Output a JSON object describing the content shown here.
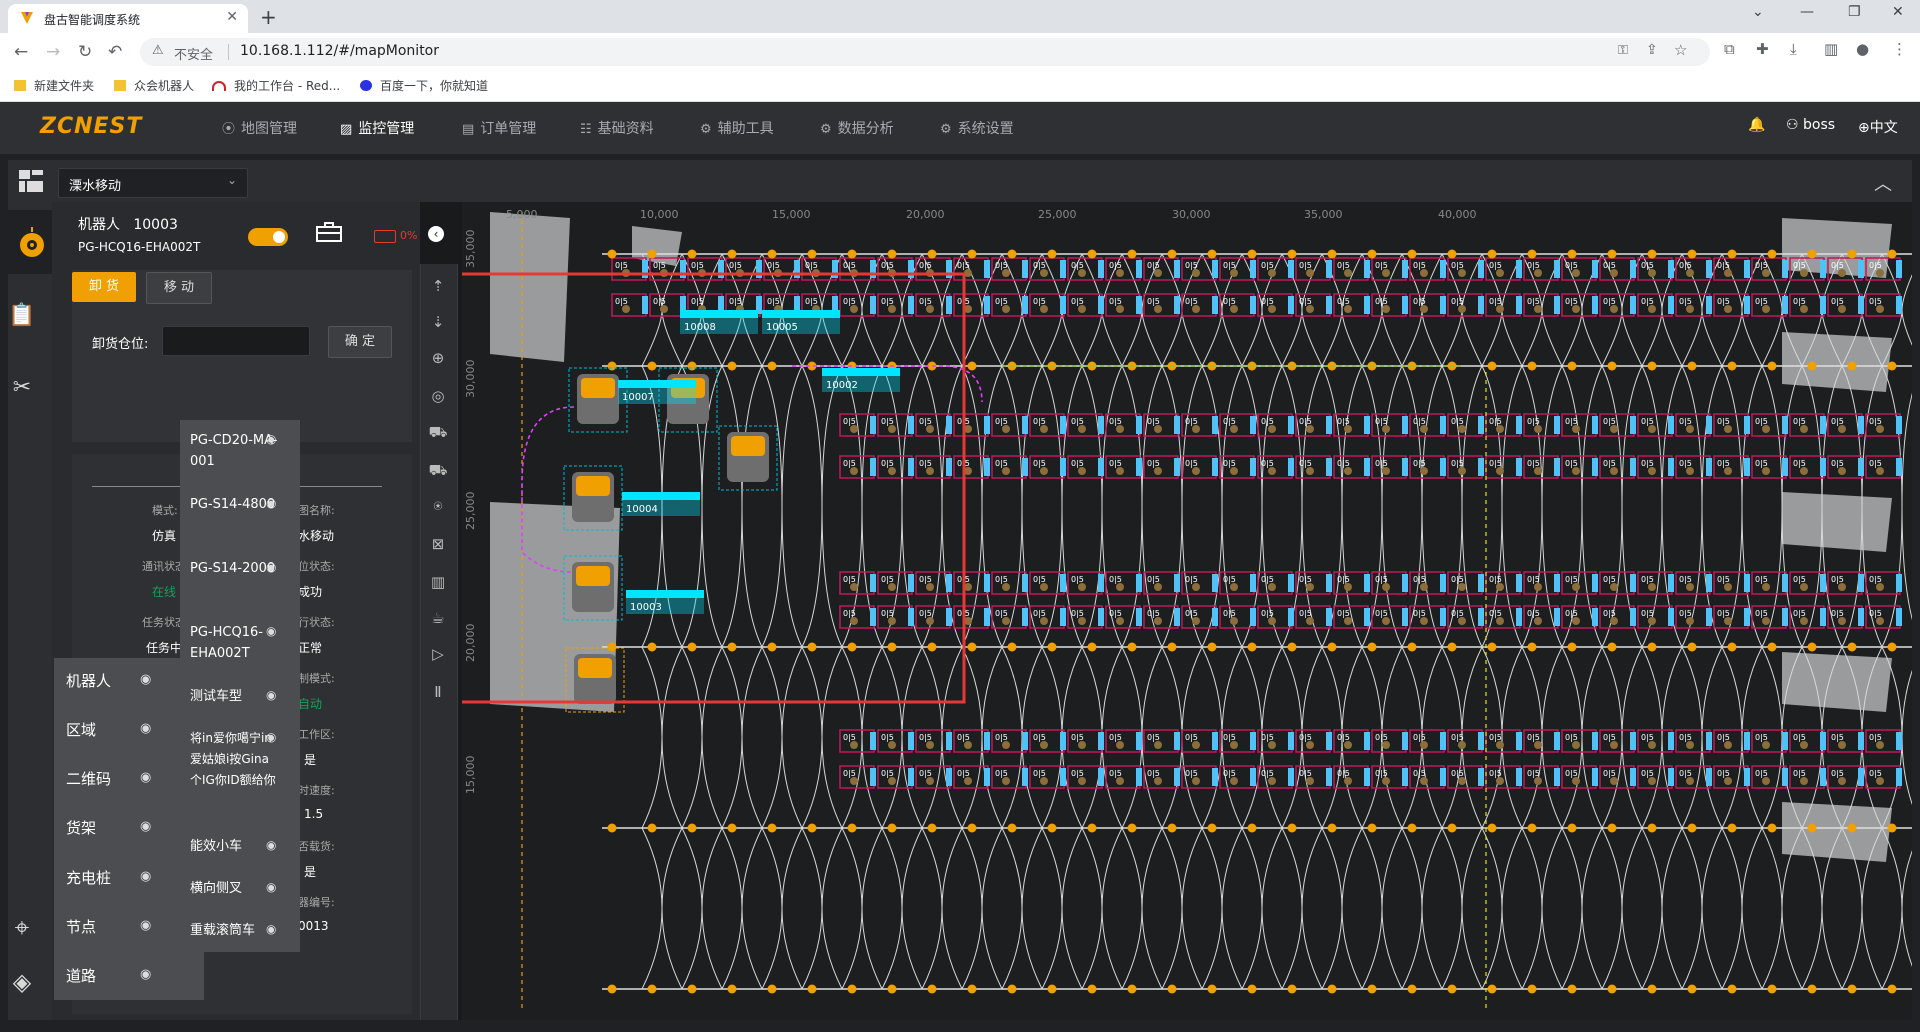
{
  "browser": {
    "tab_title": "盘古智能调度系统",
    "security": "不安全",
    "url": "10.168.1.112/#/mapMonitor",
    "bookmarks": [
      "新建文件夹",
      "众会机器人",
      "我的工作台 - Red...",
      "百度一下，你就知道"
    ]
  },
  "app": {
    "logo": "ZCNEST",
    "menu": [
      {
        "label": "地图管理",
        "icon": "map-pin-icon",
        "active": false
      },
      {
        "label": "监控管理",
        "icon": "monitor-chart-icon",
        "active": true
      },
      {
        "label": "订单管理",
        "icon": "order-icon",
        "active": false
      },
      {
        "label": "基础资料",
        "icon": "sliders-icon",
        "active": false
      },
      {
        "label": "辅助工具",
        "icon": "gear-icon",
        "active": false
      },
      {
        "label": "数据分析",
        "icon": "gear-icon",
        "active": false
      },
      {
        "label": "系统设置",
        "icon": "gear-icon",
        "active": false
      }
    ],
    "user": "boss",
    "language": "中文",
    "site": "溧水移动"
  },
  "robot_panel": {
    "title_label": "机器人",
    "robot_id": "10003",
    "model": "PG-HCQ16-EHA002T",
    "battery": "0%",
    "tabs": {
      "unload": "卸 货",
      "move": "移 动"
    },
    "location_label": "卸货仓位:",
    "location_value": "",
    "confirm": "确 定",
    "info": {
      "mode_label": "模式:",
      "mode_value": "仿真",
      "map_label": "图名称:",
      "map_value": "水移动",
      "comm_label": "通讯状态",
      "comm_value": "在线",
      "locate_label": "位状态:",
      "locate_value": "成功",
      "task_label": "任务状态",
      "task_value": "任务中",
      "run_label": "行状态:",
      "run_value": "正常",
      "ctrl_label": "制模式:",
      "ctrl_value": "自动",
      "work_label": "工作区:",
      "work_value": "是",
      "speed_label": "时速度:",
      "speed_value": "1.5",
      "load_label": "否载货:",
      "load_value": "是",
      "code_label": "器编号:",
      "code_value": "0013"
    }
  },
  "layer_menu": [
    "机器人",
    "区域",
    "二维码",
    "货架",
    "充电桩",
    "节点",
    "道路"
  ],
  "robot_type_menu": [
    "PG-CD20-MA-001",
    "PG-S14-4800",
    "PG-S14-2000",
    "PG-HCQ16-EHA002T",
    "测试车型",
    "将in爱你噶宁in爱姑娘i按Gina个IG你ID额给你",
    "能效小车",
    "横向侧叉",
    "重载滚筒车"
  ],
  "map": {
    "x_ticks": [
      "5,000",
      "10,000",
      "15,000",
      "20,000",
      "25,000",
      "30,000",
      "35,000",
      "40,000"
    ],
    "y_ticks": [
      "35,000",
      "30,000",
      "25,000",
      "20,000",
      "15,000"
    ],
    "robots": [
      "10008",
      "10005",
      "10007",
      "10002",
      "10004",
      "10003"
    ],
    "shelf_label": "0|5",
    "highlight_color": "#e53935",
    "accent_color": "#f0a000",
    "robot_label_color": "#00e5ff"
  }
}
